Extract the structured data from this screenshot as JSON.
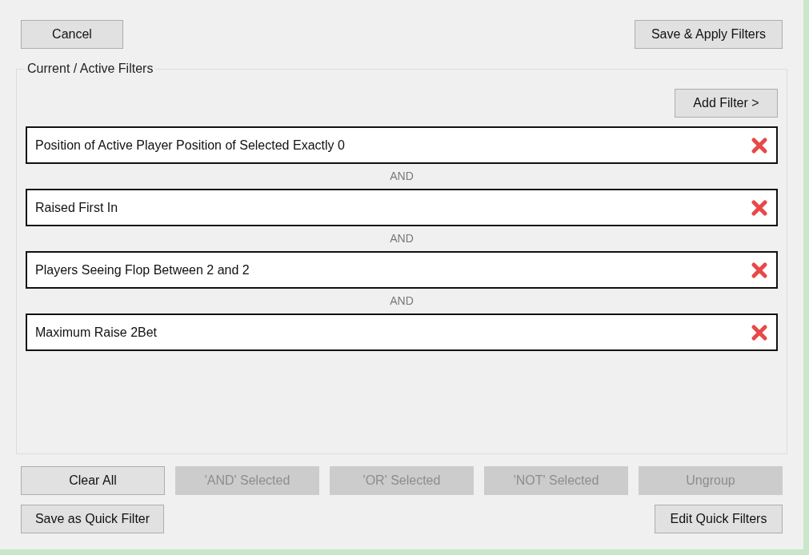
{
  "top_buttons": [
    {
      "label": "Cancel"
    },
    {
      "label": "Save & Apply Filters"
    }
  ],
  "group": {
    "title": "Current / Active Filters",
    "add_button": "Add Filter >",
    "filters": [
      {
        "text": "Position of Active Player Position of Selected Exactly 0"
      },
      {
        "text": "Raised First In"
      },
      {
        "text": "Players Seeing Flop Between 2 and 2"
      },
      {
        "text": "Maximum Raise 2Bet"
      }
    ],
    "connectors": [
      "AND",
      "AND",
      "AND"
    ]
  },
  "action_buttons": [
    {
      "label": "Clear All",
      "disabled": false
    },
    {
      "label": "'AND' Selected",
      "disabled": true
    },
    {
      "label": "'OR' Selected",
      "disabled": true
    },
    {
      "label": "'NOT' Selected",
      "disabled": true
    },
    {
      "label": "Ungroup",
      "disabled": true
    }
  ],
  "bottom_buttons": [
    {
      "label": "Save as Quick Filter"
    },
    {
      "label": "Edit Quick Filters"
    }
  ]
}
